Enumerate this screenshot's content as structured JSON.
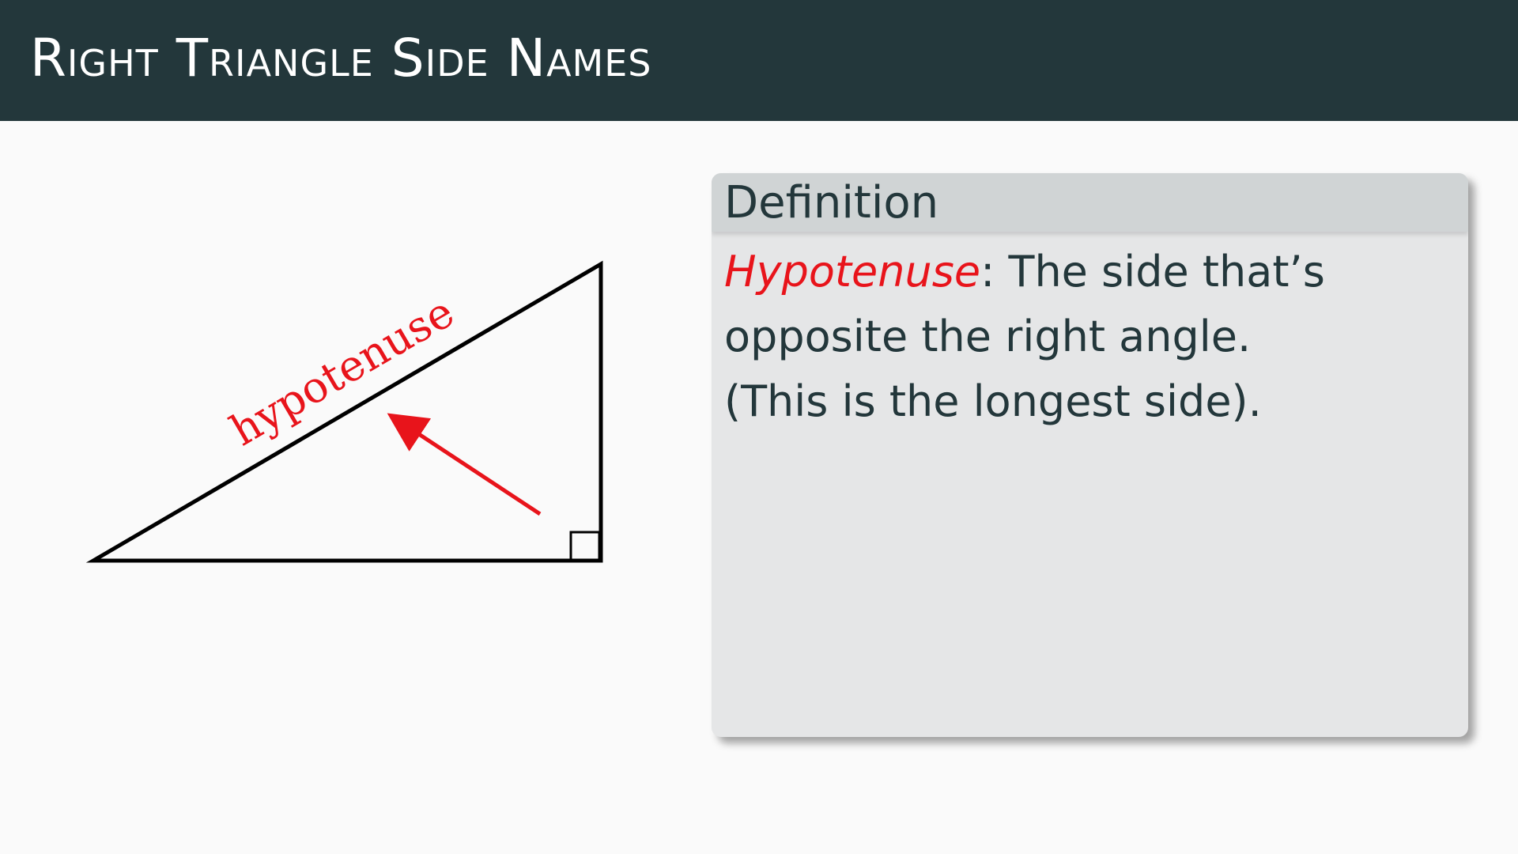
{
  "slide": {
    "title": "Right Triangle Side Names"
  },
  "diagram": {
    "side_label": "hypotenuse",
    "colors": {
      "stroke": "#000000",
      "accent": "#e8141b"
    }
  },
  "definition": {
    "header": "Definition",
    "term": "Hypotenuse",
    "separator": ":",
    "line1_rest": " The side that’s",
    "line2": "opposite the right angle.",
    "line3": "(This is the longest side)."
  },
  "colors": {
    "title_bar": "#23373b",
    "title_text": "#ffffff",
    "background": "#fafafa",
    "block_body": "#e5e6e7",
    "block_header": "#d0d4d5",
    "body_text": "#23373b",
    "term": "#e8141b"
  }
}
